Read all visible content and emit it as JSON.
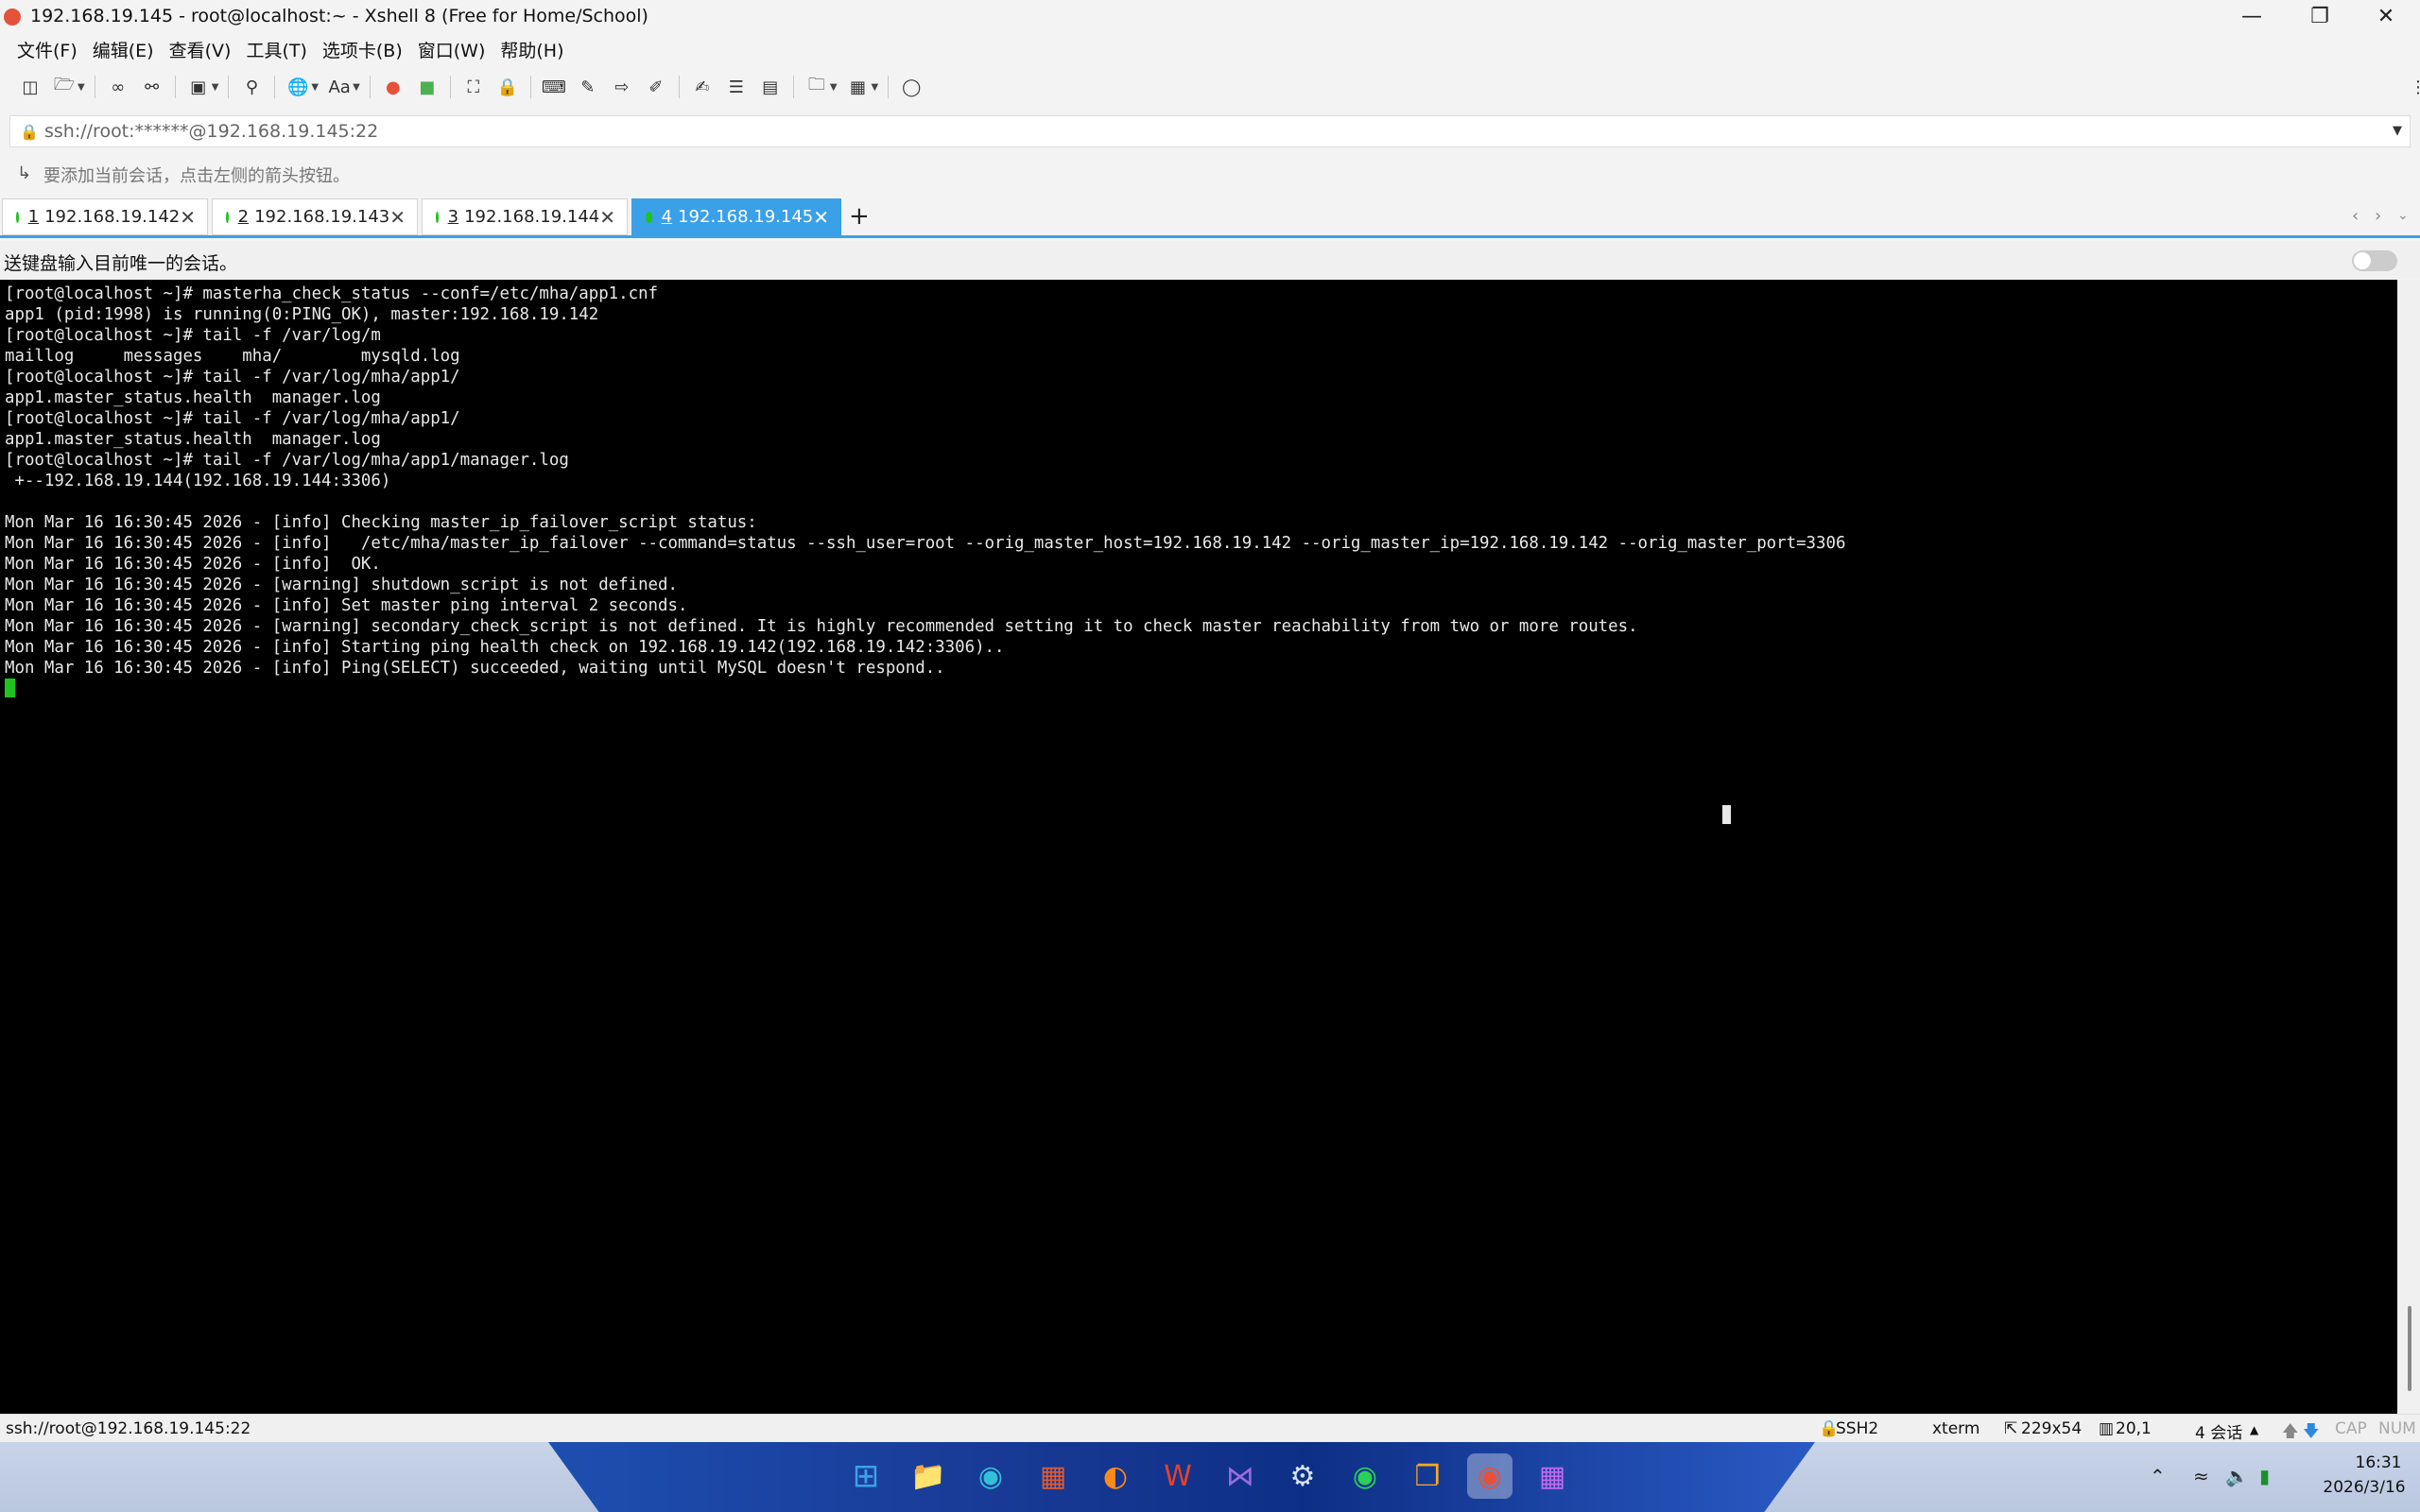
{
  "window": {
    "title": "192.168.19.145 - root@localhost:~ - Xshell 8 (Free for Home/School)"
  },
  "menu": [
    "文件(F)",
    "编辑(E)",
    "查看(V)",
    "工具(T)",
    "选项卡(B)",
    "窗口(W)",
    "帮助(H)"
  ],
  "address": {
    "url": "ssh://root:******@192.168.19.145:22"
  },
  "hint": {
    "text": "要添加当前会话，点击左侧的箭头按钮。"
  },
  "tabs": [
    {
      "num": "1",
      "label": "192.168.19.142",
      "active": false
    },
    {
      "num": "2",
      "label": "192.168.19.143",
      "active": false
    },
    {
      "num": "3",
      "label": "192.168.19.144",
      "active": false
    },
    {
      "num": "4",
      "label": "192.168.19.145",
      "active": true
    }
  ],
  "send_bar": {
    "text": "送键盘输入目前唯一的会话。"
  },
  "terminal": {
    "lines": [
      "[root@localhost ~]# masterha_check_status --conf=/etc/mha/app1.cnf",
      "app1 (pid:1998) is running(0:PING_OK), master:192.168.19.142",
      "[root@localhost ~]# tail -f /var/log/m",
      "maillog     messages    mha/        mysqld.log",
      "[root@localhost ~]# tail -f /var/log/mha/app1/",
      "app1.master_status.health  manager.log",
      "[root@localhost ~]# tail -f /var/log/mha/app1/",
      "app1.master_status.health  manager.log",
      "[root@localhost ~]# tail -f /var/log/mha/app1/manager.log",
      " +--192.168.19.144(192.168.19.144:3306)",
      "",
      "Mon Mar 16 16:30:45 2026 - [info] Checking master_ip_failover_script status:",
      "Mon Mar 16 16:30:45 2026 - [info]   /etc/mha/master_ip_failover --command=status --ssh_user=root --orig_master_host=192.168.19.142 --orig_master_ip=192.168.19.142 --orig_master_port=3306",
      "Mon Mar 16 16:30:45 2026 - [info]  OK.",
      "Mon Mar 16 16:30:45 2026 - [warning] shutdown_script is not defined.",
      "Mon Mar 16 16:30:45 2026 - [info] Set master ping interval 2 seconds.",
      "Mon Mar 16 16:30:45 2026 - [warning] secondary_check_script is not defined. It is highly recommended setting it to check master reachability from two or more routes.",
      "Mon Mar 16 16:30:45 2026 - [info] Starting ping health check on 192.168.19.142(192.168.19.142:3306)..",
      "Mon Mar 16 16:30:45 2026 - [info] Ping(SELECT) succeeded, waiting until MySQL doesn't respond.."
    ]
  },
  "status": {
    "connection": "ssh://root@192.168.19.145:22",
    "protocol": "SSH2",
    "term": "xterm",
    "size": "229x54",
    "pos": "20,1",
    "sessions": "4 会话",
    "caps": "CAP",
    "num": "NUM"
  },
  "clock": {
    "time": "16:31",
    "date": "2026/3/16"
  },
  "colors": {
    "accent": "#3aa0e8",
    "session_dot": "#1ec31e",
    "terminal_bg": "#000000",
    "terminal_fg": "#e8e8e8"
  }
}
